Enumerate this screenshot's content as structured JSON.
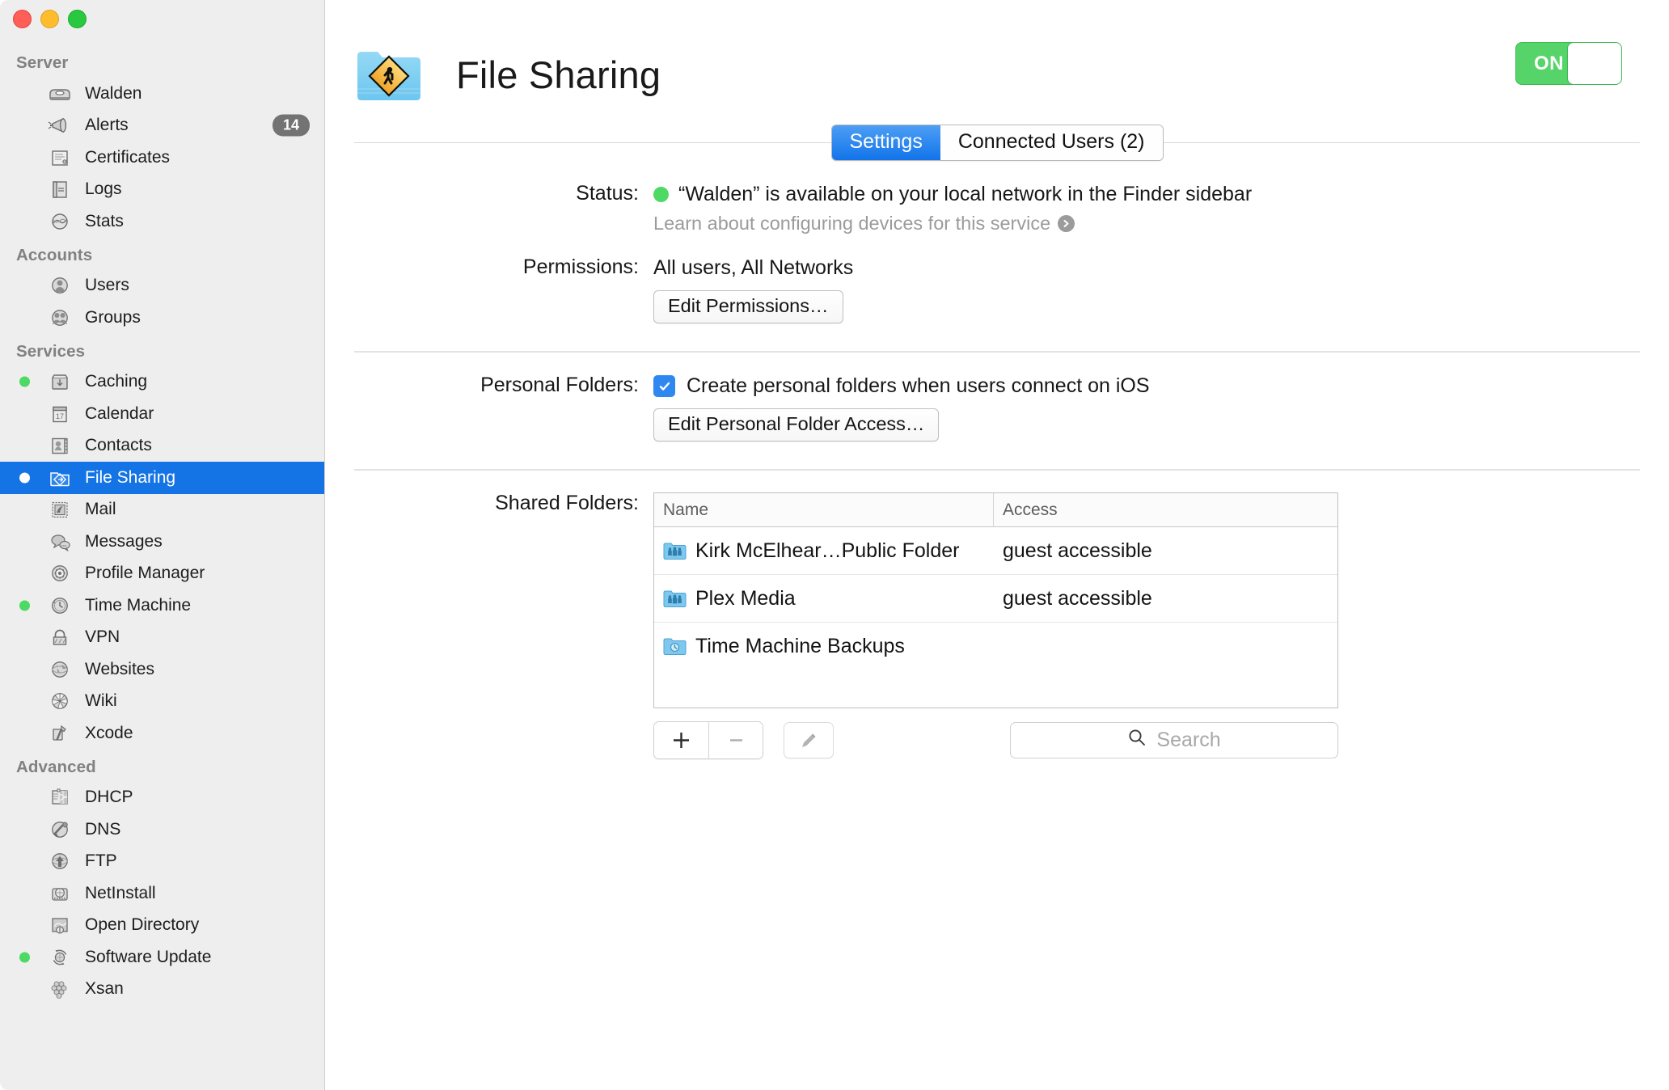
{
  "window": {
    "traffic_lights": [
      "close",
      "minimize",
      "zoom"
    ]
  },
  "sidebar": {
    "groups": [
      {
        "title": "Server",
        "items": [
          {
            "label": "Walden",
            "icon": "server-icon",
            "status": "none",
            "badge": ""
          },
          {
            "label": "Alerts",
            "icon": "megaphone-icon",
            "status": "none",
            "badge": "14"
          },
          {
            "label": "Certificates",
            "icon": "certificate-icon",
            "status": "none",
            "badge": ""
          },
          {
            "label": "Logs",
            "icon": "logs-icon",
            "status": "none",
            "badge": ""
          },
          {
            "label": "Stats",
            "icon": "stats-icon",
            "status": "none",
            "badge": ""
          }
        ]
      },
      {
        "title": "Accounts",
        "items": [
          {
            "label": "Users",
            "icon": "user-icon",
            "status": "none",
            "badge": ""
          },
          {
            "label": "Groups",
            "icon": "groups-icon",
            "status": "none",
            "badge": ""
          }
        ]
      },
      {
        "title": "Services",
        "items": [
          {
            "label": "Caching",
            "icon": "caching-icon",
            "status": "green",
            "badge": ""
          },
          {
            "label": "Calendar",
            "icon": "calendar-icon",
            "status": "none",
            "badge": "",
            "icon_text": "17"
          },
          {
            "label": "Contacts",
            "icon": "contacts-icon",
            "status": "none",
            "badge": ""
          },
          {
            "label": "File Sharing",
            "icon": "file-sharing-icon",
            "status": "white",
            "badge": "",
            "selected": true
          },
          {
            "label": "Mail",
            "icon": "mail-stamp-icon",
            "status": "none",
            "badge": ""
          },
          {
            "label": "Messages",
            "icon": "messages-icon",
            "status": "none",
            "badge": ""
          },
          {
            "label": "Profile Manager",
            "icon": "gear-icon",
            "status": "none",
            "badge": ""
          },
          {
            "label": "Time Machine",
            "icon": "clock-icon",
            "status": "green",
            "badge": ""
          },
          {
            "label": "VPN",
            "icon": "lock-icon",
            "status": "none",
            "badge": ""
          },
          {
            "label": "Websites",
            "icon": "globe-icon",
            "status": "none",
            "badge": ""
          },
          {
            "label": "Wiki",
            "icon": "wiki-icon",
            "status": "none",
            "badge": ""
          },
          {
            "label": "Xcode",
            "icon": "hammer-icon",
            "status": "none",
            "badge": ""
          }
        ]
      },
      {
        "title": "Advanced",
        "items": [
          {
            "label": "DHCP",
            "icon": "dhcp-icon",
            "status": "none",
            "badge": ""
          },
          {
            "label": "DNS",
            "icon": "dns-tools-icon",
            "status": "none",
            "badge": ""
          },
          {
            "label": "FTP",
            "icon": "ftp-upload-icon",
            "status": "none",
            "badge": ""
          },
          {
            "label": "NetInstall",
            "icon": "netinstall-disk-icon",
            "status": "none",
            "badge": ""
          },
          {
            "label": "Open Directory",
            "icon": "open-directory-icon",
            "status": "none",
            "badge": ""
          },
          {
            "label": "Software Update",
            "icon": "software-update-icon",
            "status": "green",
            "badge": ""
          },
          {
            "label": "Xsan",
            "icon": "xsan-icon",
            "status": "none",
            "badge": ""
          }
        ]
      }
    ]
  },
  "header": {
    "title": "File Sharing",
    "icon": "file-sharing-folder-icon",
    "toggle": {
      "label": "ON",
      "state": "on",
      "color": "#56d46a"
    }
  },
  "tabs": [
    {
      "label": "Settings",
      "active": true
    },
    {
      "label": "Connected Users (2)",
      "active": false
    }
  ],
  "settings": {
    "status": {
      "label": "Status:",
      "indicator_color": "#4cd964",
      "text": "“Walden” is available on your local network in the Finder sidebar",
      "learn_more": "Learn about configuring devices for this service"
    },
    "permissions": {
      "label": "Permissions:",
      "value": "All users, All Networks",
      "button": "Edit Permissions…"
    },
    "personal_folders": {
      "label": "Personal Folders:",
      "checkbox_checked": true,
      "checkbox_label": "Create personal folders when users connect on iOS",
      "button": "Edit Personal Folder Access…"
    },
    "shared_folders": {
      "label": "Shared Folders:",
      "columns": [
        "Name",
        "Access"
      ],
      "rows": [
        {
          "name": "Kirk McElhear…Public Folder",
          "access": "guest accessible",
          "icon": "shared-folder-icon"
        },
        {
          "name": "Plex Media",
          "access": "guest accessible",
          "icon": "shared-folder-icon"
        },
        {
          "name": "Time Machine Backups",
          "access": "",
          "icon": "time-machine-folder-icon"
        }
      ],
      "tools": {
        "add": "+",
        "remove": "–",
        "edit": "pencil-icon",
        "search_placeholder": "Search"
      }
    }
  }
}
